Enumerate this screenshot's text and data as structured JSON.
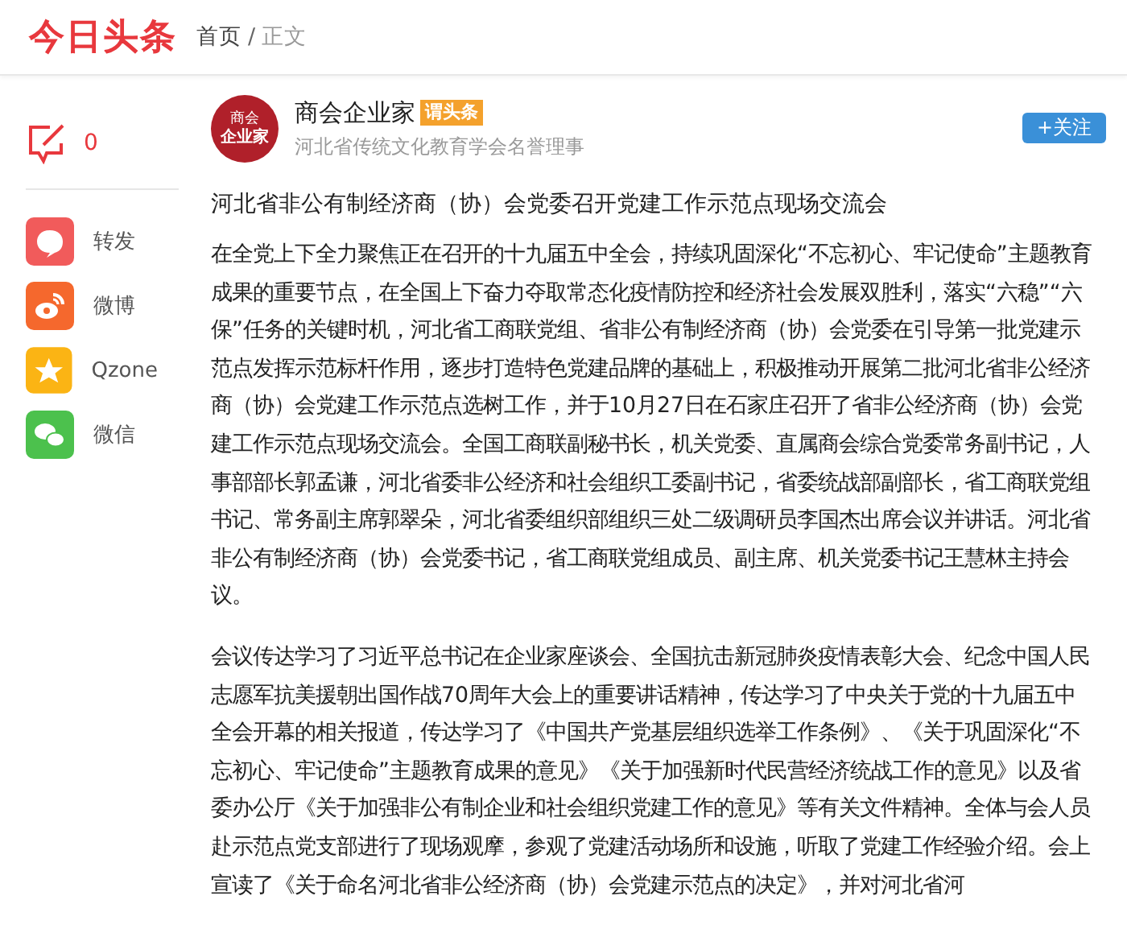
{
  "header": {
    "logo": "今日头条",
    "breadcrumb_separator": "/",
    "breadcrumb": [
      {
        "label": "首页",
        "selected": false
      },
      {
        "label": "正文",
        "selected": true
      }
    ]
  },
  "sidebar": {
    "comment_count": "0",
    "share": [
      {
        "kind": "repost",
        "label": "转发"
      },
      {
        "kind": "weibo",
        "label": "微博"
      },
      {
        "kind": "qzone",
        "label": "Qzone"
      },
      {
        "kind": "wechat",
        "label": "微信"
      }
    ]
  },
  "author": {
    "avatar_lines": [
      "商会",
      "企业家"
    ],
    "name": "商会企业家",
    "badge": "谓头条",
    "description": "河北省传统文化教育学会名誉理事",
    "follow": "+关注"
  },
  "article": {
    "title": "河北省非公有制经济商（协）会党委召开党建工作示范点现场交流会",
    "paragraphs": [
      "在全党上下全力聚焦正在召开的十九届五中全会，持续巩固深化“不忘初心、牢记使命”主题教育成果的重要节点，在全国上下奋力夺取常态化疫情防控和经济社会发展双胜利，落实“六稳”“六保”任务的关键时机，河北省工商联党组、省非公有制经济商（协）会党委在引导第一批党建示范点发挥示范标杆作用，逐步打造特色党建品牌的基础上，积极推动开展第二批河北省非公经济商（协）会党建工作示范点选树工作，并于10月27日在石家庄召开了省非公经济商（协）会党建工作示范点现场交流会。全国工商联副秘书长，机关党委、直属商会综合党委常务副书记，人事部部长郭孟谦，河北省委非公经济和社会组织工委副书记，省委统战部副部长，省工商联党组书记、常务副主席郭翠朵，河北省委组织部组织三处二级调研员李国杰出席会议并讲话。河北省非公有制经济商（协）会党委书记，省工商联党组成员、副主席、机关党委书记王慧林主持会议。",
      "会议传达学习了习近平总书记在企业家座谈会、全国抗击新冠肺炎疫情表彰大会、纪念中国人民志愿军抗美援朝出国作战70周年大会上的重要讲话精神，传达学习了中央关于党的十九届五中全会开幕的相关报道，传达学习了《中国共产党基层组织选举工作条例》、《关于巩固深化“不忘初心、牢记使命”主题教育成果的意见》《关于加强新时代民营经济统战工作的意见》以及省委办公厅《关于加强非公有制企业和社会组织党建工作的意见》等有关文件精神。全体与会人员赴示范点党支部进行了现场观摩，参观了党建活动场所和设施，听取了党建工作经验介绍。会上宣读了《关于命名河北省非公经济商（协）会党建示范点的决定》，并对河北省河"
    ]
  }
}
